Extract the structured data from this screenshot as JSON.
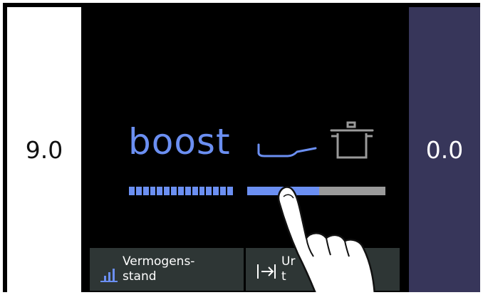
{
  "left_panel": {
    "value": "9.0"
  },
  "right_panel": {
    "value": "0.0"
  },
  "center": {
    "mode_label": "boost",
    "icons": [
      "pan-icon",
      "pot-icon"
    ],
    "power_segments": 15,
    "slider_level_percent": 52
  },
  "buttons": [
    {
      "icon": "bar-chart-icon",
      "line1": "Vermogens-",
      "line2": "stand"
    },
    {
      "icon": "arrow-to-bar-icon",
      "line1": "Ur",
      "line2": "t"
    }
  ],
  "colors": {
    "accent": "#6b8ff2",
    "right_panel": "#37365a",
    "button_bg": "#2e3635",
    "track": "#9a9a9a"
  }
}
